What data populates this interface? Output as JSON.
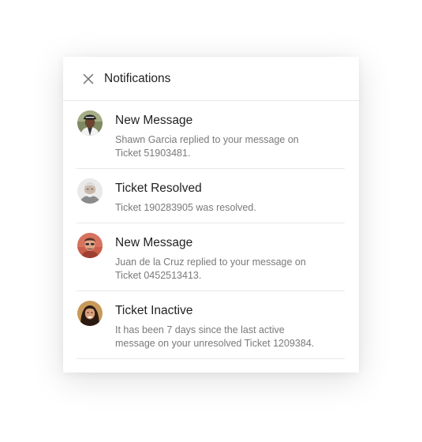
{
  "header": {
    "title": "Notifications",
    "close_icon": "close-icon"
  },
  "notifications": [
    {
      "title": "New Message",
      "body": "Shawn Garcia replied to your message on Ticket 51903481.",
      "avatar": "avatar-shawn-garcia"
    },
    {
      "title": "Ticket Resolved",
      "body": "Ticket 190283905 was resolved.",
      "avatar": "avatar-system"
    },
    {
      "title": "New Message",
      "body": "Juan de la Cruz replied to your message on Ticket 0452513413.",
      "avatar": "avatar-juan-de-la-cruz"
    },
    {
      "title": "Ticket Inactive",
      "body": "It has been 7 days since the last active message on your unresolved Ticket 1209384.",
      "avatar": "avatar-system"
    }
  ],
  "colors": {
    "title_text": "#222222",
    "body_text": "#7a7a7a",
    "divider": "#e8e8e8",
    "panel_bg": "#ffffff"
  }
}
